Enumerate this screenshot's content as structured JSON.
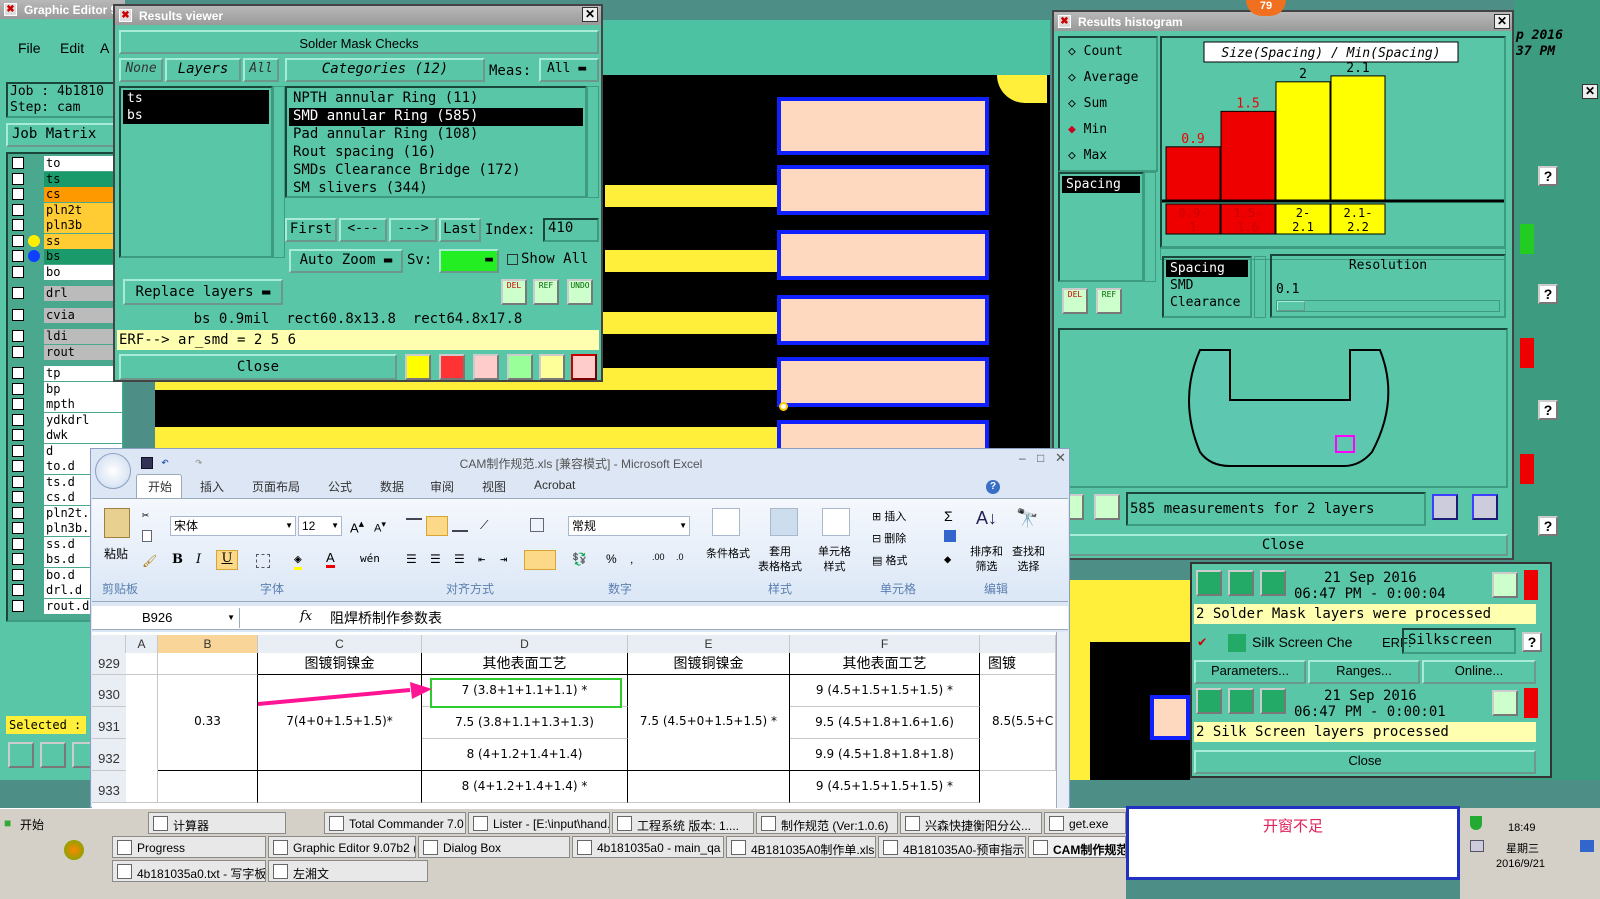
{
  "graphic_editor": {
    "title": "Graphic Editor 9",
    "menu": [
      "File",
      "Edit",
      "A"
    ],
    "job": "Job : 4b1810",
    "step": "Step: cam",
    "job_matrix": "Job Matrix",
    "selected": "Selected :",
    "layers": [
      "to",
      "ts",
      "cs",
      "pln2t",
      "pln3b",
      "ss",
      "bs",
      "bo",
      "drl",
      "cvia",
      "ldi",
      "rout",
      "tp",
      "bp",
      "mpth",
      "ydkdrl",
      "dwk",
      "d",
      "to.d",
      "ts.d",
      "cs.d",
      "pln2t.",
      "pln3b.",
      "ss.d",
      "bs.d",
      "bo.d",
      "drl.d",
      "rout.d"
    ]
  },
  "results_viewer": {
    "title": "Results viewer",
    "heading": "Solder Mask Checks",
    "none_btn": "None",
    "layers_btn": "Layers",
    "all_btn": "All",
    "categories_btn": "Categories (12)",
    "meas_label": "Meas:",
    "meas_value": "All",
    "layer_items": [
      "ts",
      "bs"
    ],
    "categories": [
      "NPTH annular Ring (11)",
      "SMD annular Ring (585)",
      "Pad annular Ring (108)",
      "Rout spacing (16)",
      "SMDs Clearance Bridge (172)",
      "SM slivers (344)"
    ],
    "first": "First",
    "prev": "<---",
    "next": "--->",
    "last": "Last",
    "index_label": "Index:",
    "index_value": "410",
    "auto_zoom": "Auto Zoom",
    "sv_label": "Sv:",
    "show_all": "Show All",
    "replace_layers": "Replace layers",
    "del": "DEL",
    "ref": "REF",
    "undo": "UNDO",
    "measure_line": "bs 0.9mil  rect60.8x13.8  rect64.8x17.8",
    "erf_line": "ERF--> ar_smd = 2 5 6",
    "close": "Close"
  },
  "histogram": {
    "title": "Results histogram",
    "stats": [
      "Count",
      "Average",
      "Sum",
      "Min",
      "Max"
    ],
    "selected_stat": "Min",
    "chart_title": "Size(Spacing) / Min(Spacing)",
    "spacing_list": [
      "Spacing"
    ],
    "category_list": [
      "Spacing",
      "SMD",
      "Clearance"
    ],
    "resolution_label": "Resolution",
    "resolution_value": "0.1",
    "del": "DEL",
    "ref": "REF",
    "status": "585 measurements for 2 layers",
    "close": "Close"
  },
  "chart_data": {
    "type": "bar",
    "title": "Size(Spacing) / Min(Spacing)",
    "categories": [
      "0.9-1",
      "1.5-1.6",
      "2-2.1",
      "2.1-2.2"
    ],
    "values": [
      0.9,
      1.5,
      2,
      2.1
    ],
    "bar_labels": [
      "0.9",
      "1.5",
      "2",
      "2.1"
    ],
    "colors": [
      "#ee0000",
      "#ee0000",
      "#ffff00",
      "#ffff00"
    ],
    "xlabel": "",
    "ylabel": ""
  },
  "right_panel": {
    "date1": "21 Sep 2016",
    "time1": "06:47 PM - 0:00:04",
    "msg1": "2 Solder Mask layers were processed",
    "silk_label": "Silk Screen Che",
    "erf_label": "ERF:",
    "erf_value": "Silkscreen",
    "params": "Parameters...",
    "ranges": "Ranges...",
    "online": "Online...",
    "date2": "21 Sep 2016",
    "time2": "06:47 PM - 0:00:01",
    "msg2": "2 Silk Screen layers processed",
    "close": "Close",
    "top_date": "p 2016",
    "top_time": "37 PM",
    "badge": "79"
  },
  "excel": {
    "title": "CAM制作规范.xls [兼容模式] - Microsoft Excel",
    "tabs": [
      "开始",
      "插入",
      "页面布局",
      "公式",
      "数据",
      "审阅",
      "视图",
      "Acrobat"
    ],
    "font_name": "宋体",
    "font_size": "12",
    "number_format": "常规",
    "groups": [
      "剪贴板",
      "字体",
      "对齐方式",
      "数字",
      "样式",
      "单元格",
      "编辑"
    ],
    "paste": "粘贴",
    "cond_format": "条件格式",
    "table_format": "套用\n表格格式",
    "cell_style": "单元格\n样式",
    "insert": "插入",
    "delete": "删除",
    "format": "格式",
    "sort": "排序和\n筛选",
    "find": "查找和\n选择",
    "name_box": "B926",
    "fx": "fx",
    "formula": "阻焊桥制作参数表",
    "col_headers": [
      "A",
      "B",
      "C",
      "D",
      "E",
      "F"
    ],
    "row_headers": [
      "929",
      "930",
      "931",
      "932",
      "933"
    ],
    "r929": {
      "c": "图镀铜镍金",
      "d": "其他表面工艺",
      "e": "图镀铜镍金",
      "f": "其他表面工艺",
      "g": "图镀"
    },
    "b930": "0.33",
    "c930": "7(4+0+1.5+1.5)*",
    "d930": "7 (3.8+1+1.1+1.1) *",
    "d931": "7.5 (3.8+1.1+1.3+1.3)",
    "d932": "8 (4+1.2+1.4+1.4)",
    "d933": "8 (4+1.2+1.4+1.4) *",
    "e930": "7.5 (4.5+0+1.5+1.5) *",
    "f930": "9 (4.5+1.5+1.5+1.5) *",
    "f931": "9.5 (4.5+1.8+1.6+1.6)",
    "f932": "9.9 (4.5+1.8+1.8+1.8)",
    "f933": "9 (4.5+1.5+1.5+1.5) *",
    "g930": "8.5(5.5+C"
  },
  "taskbar": {
    "start": "开始",
    "row1": [
      "计算器",
      "Total Commander 7.0 ...",
      "Lister - [E:\\input\\hand...",
      "工程系统  版本: 1....",
      "制作规范 (Ver:1.0.6)",
      "兴森快捷衡阳分公...",
      "get.exe"
    ],
    "row2": [
      "Progress",
      "Graphic Editor 9.07b2 (...",
      "Dialog Box",
      "4b181035a0 - main_qa",
      "4B181035A0制作单.xls...",
      "4B181035A0-预审指示...",
      "CAM制作规范"
    ],
    "row3": [
      "4b181035a0.txt - 写字板",
      "左湘文"
    ],
    "time": "18:49",
    "weekday": "星期三",
    "date": "2016/9/21"
  },
  "note": {
    "text": "开窗不足"
  }
}
